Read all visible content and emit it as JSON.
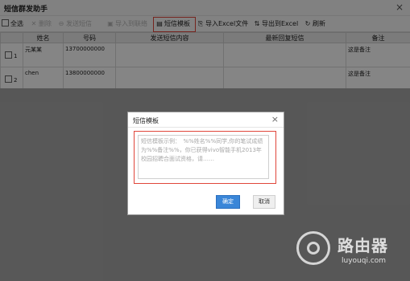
{
  "window": {
    "title": "短信群发助手",
    "close_glyph": "×"
  },
  "toolbar": {
    "select_all": "全选",
    "delete": "删除",
    "send_sms": "发送短信",
    "import_contacts": "导入到联络",
    "sms_template": "短信模板",
    "import_excel": "导入Excel文件",
    "export_excel": "导出到Excel",
    "refresh": "刷新"
  },
  "table": {
    "columns": [
      "",
      "姓名",
      "号码",
      "发送短信内容",
      "最新回复短信",
      "备注"
    ],
    "rows": [
      {
        "index": "1",
        "name": "元某某",
        "number": "13700000000",
        "content": "",
        "reply": "",
        "note": "这是备注"
      },
      {
        "index": "2",
        "name": "chen",
        "number": "13800000000",
        "content": "",
        "reply": "",
        "note": "这是备注"
      }
    ]
  },
  "dialog": {
    "title": "短信模板",
    "close_glyph": "×",
    "template_text": "短信模板示例：　%%姓名%%同学,你的笔试成绩为%%备注%%，你已获得vivo智能手机2013年校园招聘合面试资格，请……",
    "ok": "确定",
    "cancel": "取消"
  },
  "watermark": {
    "name": "路由器",
    "url": "luyouqi.com"
  }
}
